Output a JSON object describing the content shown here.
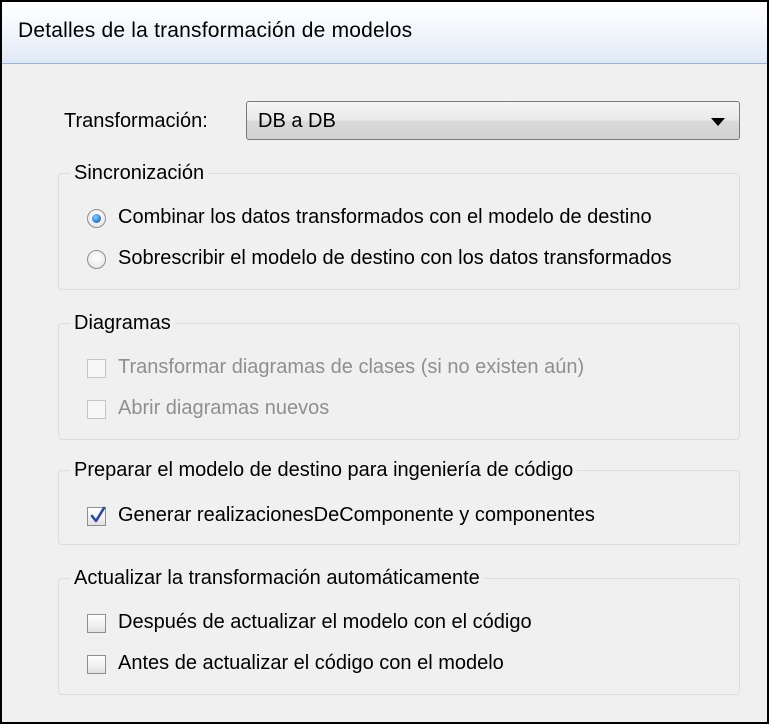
{
  "header": {
    "title": "Detalles de la transformación de modelos"
  },
  "transformation": {
    "label": "Transformación:",
    "selected": "DB a DB"
  },
  "sync": {
    "legend": "Sincronización",
    "options": [
      {
        "label": "Combinar los datos transformados con el modelo de destino",
        "checked": true
      },
      {
        "label": "Sobrescribir el modelo de destino con los datos transformados",
        "checked": false
      }
    ]
  },
  "diagrams": {
    "legend": "Diagramas",
    "options": [
      {
        "label": "Transformar diagramas de clases (si no existen aún)",
        "checked": false,
        "enabled": false
      },
      {
        "label": "Abrir diagramas nuevos",
        "checked": false,
        "enabled": false
      }
    ]
  },
  "prepare": {
    "legend": "Preparar el modelo de destino para ingeniería de código",
    "options": [
      {
        "label": "Generar realizacionesDeComponente y componentes",
        "checked": true
      }
    ]
  },
  "auto_update": {
    "legend": "Actualizar la transformación automáticamente",
    "options": [
      {
        "label": "Después de actualizar el modelo con el código",
        "checked": false
      },
      {
        "label": "Antes de actualizar el código con el modelo",
        "checked": false
      }
    ]
  },
  "colors": {
    "radio_selected": "#2b7fd1",
    "checkmark": "#2a4a9a",
    "disabled_text": "#8f8f8f",
    "group_border": "#d5dfe5"
  }
}
